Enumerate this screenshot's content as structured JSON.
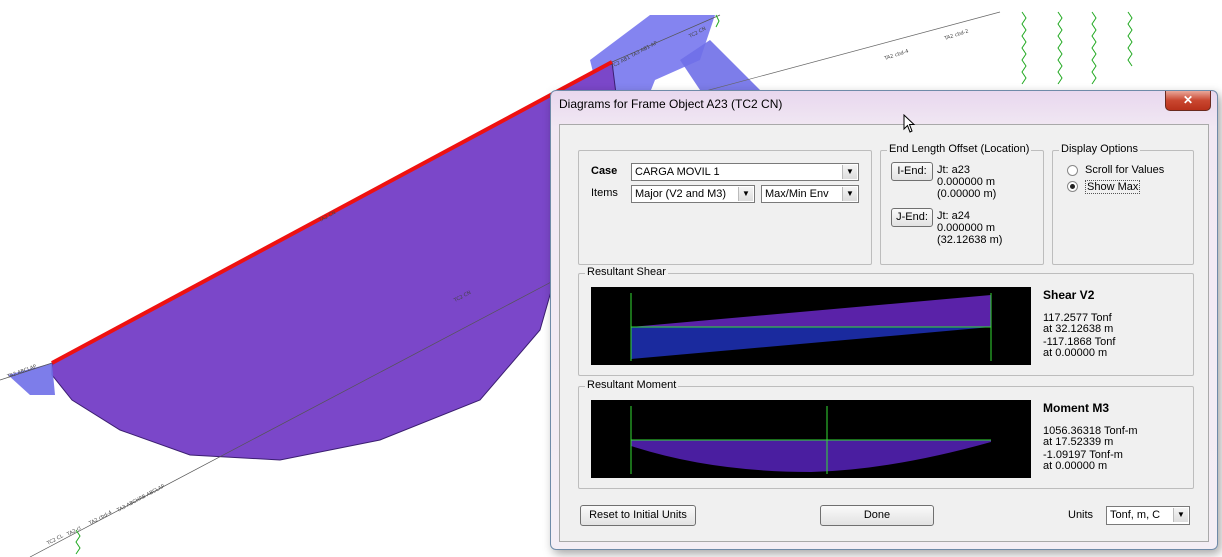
{
  "canvas": {
    "labels": [
      "TC2 CL",
      "TA2 cl",
      "TA2 CN",
      "TA2 cbd-4",
      "TC2 CN",
      "TA3 ABCHRB ABCLAP",
      "TA2 ABCLAP",
      "TC2 AB1 TA3 AB1 AP",
      "TA2 cbd-4",
      "TA2 cbd-2",
      "TC2 CN"
    ],
    "diagram_color": "#7a48c8",
    "highlight_color": "#ee1111"
  },
  "dialog": {
    "title": "Diagrams for Frame Object A23  (TC2 CN)",
    "close_label": "✕",
    "case": {
      "label": "Case",
      "value": "CARGA MOVIL 1"
    },
    "items": {
      "label": "Items",
      "component": "Major (V2 and M3)",
      "envelope": "Max/Min Env"
    },
    "end_offset": {
      "title": "End Length Offset (Location)",
      "i_end": {
        "button": "I-End:",
        "joint": "Jt:  a23",
        "offset": "0.000000 m",
        "location": "(0.00000 m)"
      },
      "j_end": {
        "button": "J-End:",
        "joint": "Jt:  a24",
        "offset": "0.000000 m",
        "location": "(32.12638 m)"
      }
    },
    "display_options": {
      "title": "Display Options",
      "options": [
        "Scroll for Values",
        "Show Max"
      ],
      "selected": "Show Max"
    },
    "shear": {
      "title": "Resultant Shear",
      "heading": "Shear V2",
      "max_value": "117.2577 Tonf",
      "max_location": "at 32.12638 m",
      "min_value": "-117.1868 Tonf",
      "min_location": "at 0.00000 m"
    },
    "moment": {
      "title": "Resultant Moment",
      "heading": "Moment M3",
      "max_value": "1056.36318 Tonf-m",
      "max_location": "at 17.52339 m",
      "min_value": "-1.09197 Tonf-m",
      "min_location": "at 0.00000 m"
    },
    "buttons": {
      "reset": "Reset to Initial Units",
      "done": "Done"
    },
    "units": {
      "label": "Units",
      "value": "Tonf, m, C"
    }
  }
}
